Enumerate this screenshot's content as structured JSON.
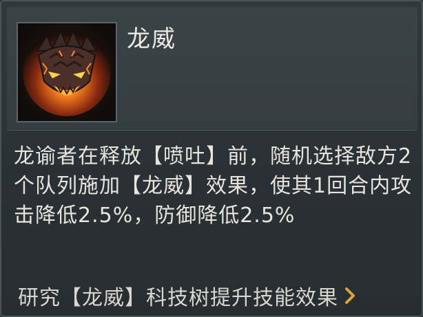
{
  "skill": {
    "title": "龙威",
    "icon": "dragon-head-icon",
    "description": "龙谕者在释放【喷吐】前，随机选择敌方2个队列施加【龙威】效果，使其1回合内攻击降低2.5%，防御降低2.5%"
  },
  "footer": {
    "research_label": "研究【龙威】科技树提升技能效果",
    "chevron_icon": "chevron-right-icon"
  },
  "colors": {
    "accent": "#d9a23a",
    "text": "#e8e4dc",
    "panel": "#2b3237"
  }
}
